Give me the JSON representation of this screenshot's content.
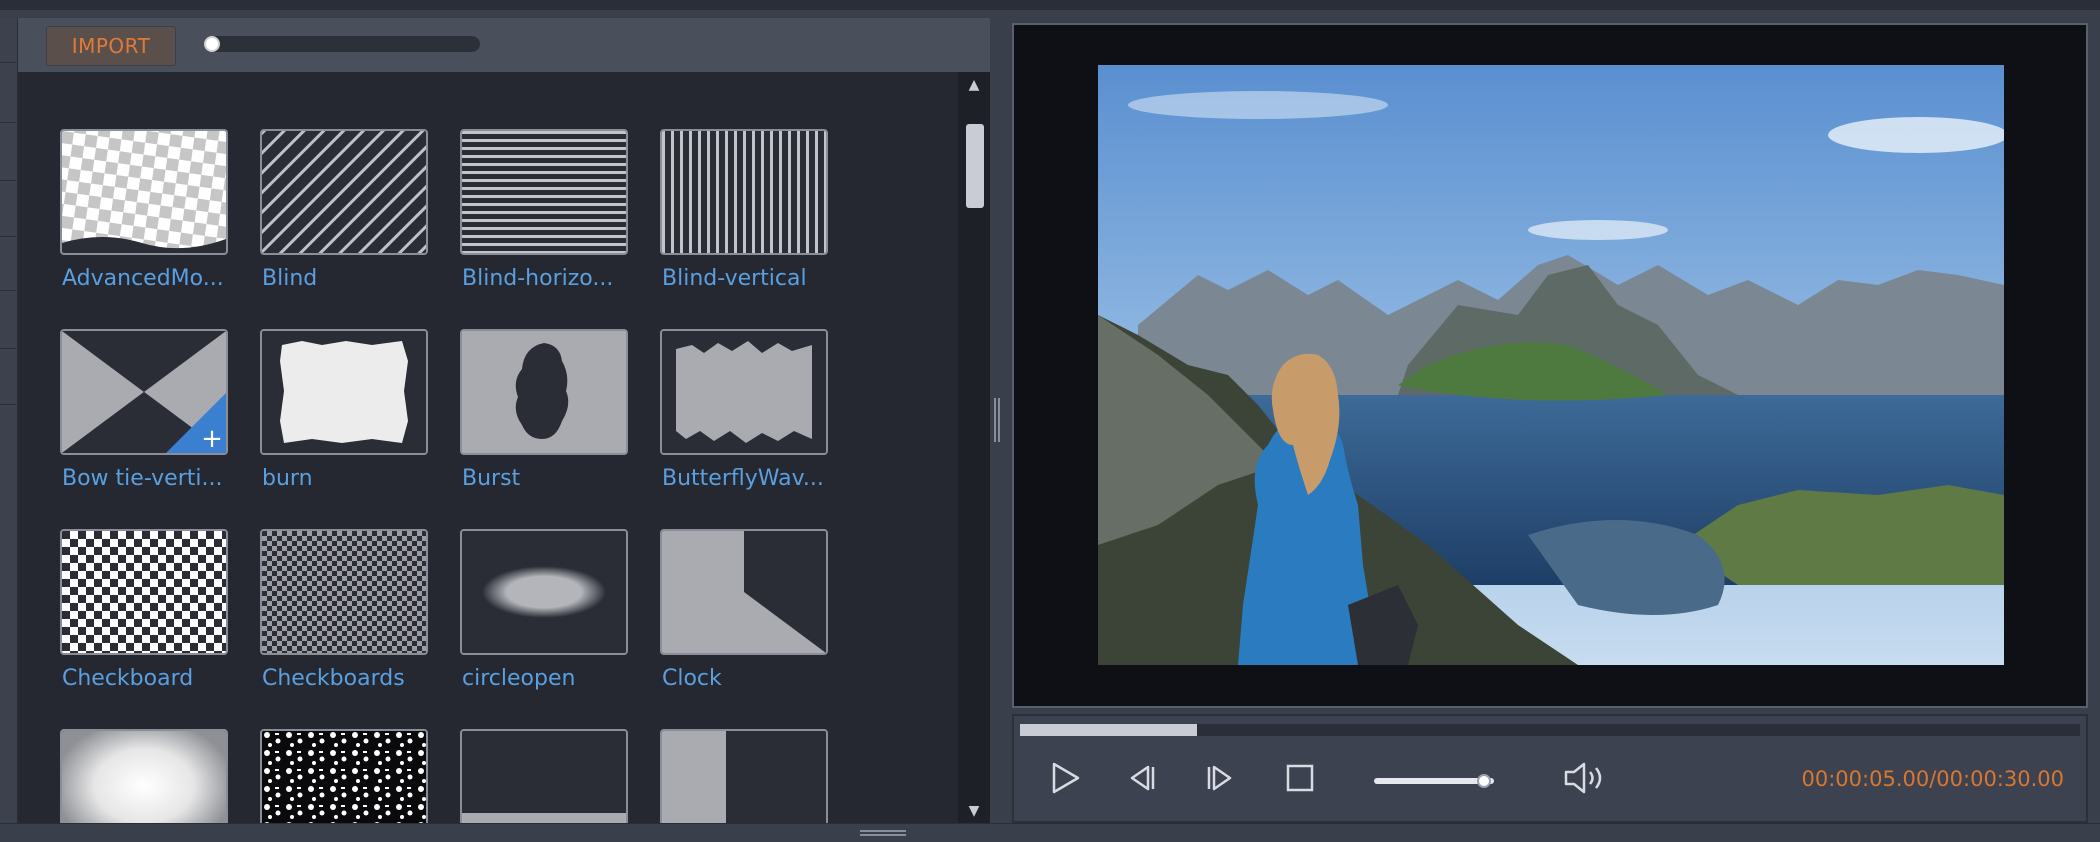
{
  "toolbar": {
    "import_label": "IMPORT",
    "thumb_zoom": 0.0
  },
  "transitions": [
    {
      "label": "AdvancedMo...",
      "icon": "advanced-mosaic-thumb"
    },
    {
      "label": "Blind",
      "icon": "blind-thumb"
    },
    {
      "label": "Blind-horizo...",
      "icon": "blind-horizontal-thumb"
    },
    {
      "label": "Blind-vertical",
      "icon": "blind-vertical-thumb"
    },
    {
      "label": "Bow tie-verti...",
      "icon": "bow-tie-vertical-thumb",
      "badge": "+"
    },
    {
      "label": "burn",
      "icon": "burn-thumb"
    },
    {
      "label": "Burst",
      "icon": "burst-thumb"
    },
    {
      "label": "ButterflyWav...",
      "icon": "butterfly-wave-thumb"
    },
    {
      "label": "Checkboard",
      "icon": "checkboard-thumb"
    },
    {
      "label": "Checkboards",
      "icon": "checkboards-thumb"
    },
    {
      "label": "circleopen",
      "icon": "circleopen-thumb"
    },
    {
      "label": "Clock",
      "icon": "clock-thumb"
    },
    {
      "label": "",
      "icon": "cloud-thumb"
    },
    {
      "label": "",
      "icon": "noise-thumb"
    },
    {
      "label": "",
      "icon": "wipe-up-thumb"
    },
    {
      "label": "",
      "icon": "wipe-right-thumb"
    }
  ],
  "player": {
    "progress_fraction": 0.167,
    "volume_fraction": 0.92,
    "timecode": "00:00:05.00/00:00:30.00",
    "icons": {
      "play": "play-icon",
      "prev_frame": "prev-frame-icon",
      "next_frame": "next-frame-icon",
      "stop": "stop-icon",
      "volume": "volume-icon"
    }
  },
  "colors": {
    "label": "#5a9fe0",
    "accent": "#e07a3a",
    "timecode": "#d9772f",
    "panel": "#252830"
  }
}
